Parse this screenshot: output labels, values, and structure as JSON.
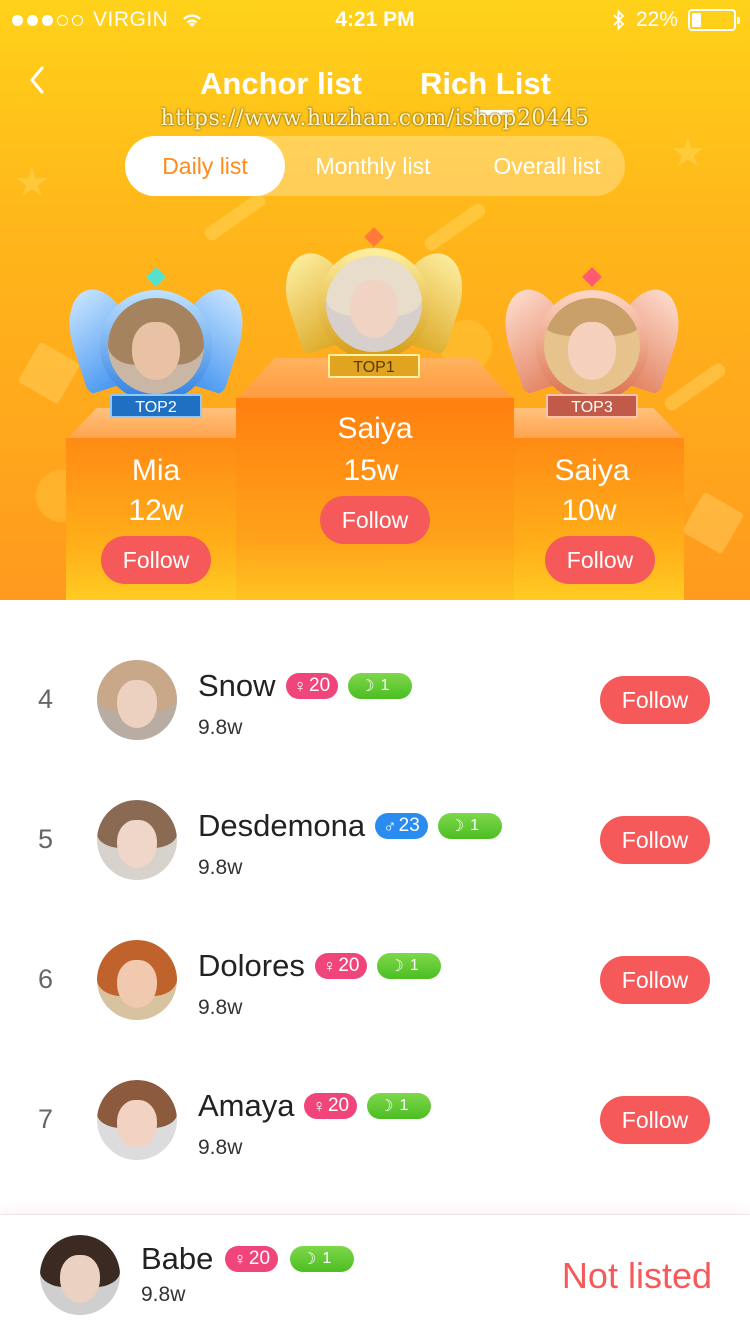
{
  "status_bar": {
    "carrier": "VIRGIN",
    "time": "4:21 PM",
    "battery": "22%",
    "battery_level": 0.22
  },
  "header": {
    "tabs": [
      {
        "label": "Anchor list",
        "active": false
      },
      {
        "label": "Rich List",
        "active": true
      }
    ],
    "watermark": "https://www.huzhan.com/ishop20445",
    "periods": [
      {
        "label": "Daily list",
        "active": true
      },
      {
        "label": "Monthly list",
        "active": false
      },
      {
        "label": "Overall list",
        "active": false
      }
    ]
  },
  "podium": [
    {
      "rank_label": "TOP2",
      "name": "Mia",
      "score": "12w",
      "follow": "Follow",
      "crown": "silver-blue"
    },
    {
      "rank_label": "TOP1",
      "name": "Saiya",
      "score": "15w",
      "follow": "Follow",
      "crown": "gold"
    },
    {
      "rank_label": "TOP3",
      "name": "Saiya",
      "score": "10w",
      "follow": "Follow",
      "crown": "bronze"
    }
  ],
  "list": [
    {
      "rank": "4",
      "name": "Snow",
      "gender": "female",
      "age": "20",
      "level": "1",
      "score": "9.8w",
      "follow": "Follow"
    },
    {
      "rank": "5",
      "name": "Desdemona",
      "gender": "male",
      "age": "23",
      "level": "1",
      "score": "9.8w",
      "follow": "Follow"
    },
    {
      "rank": "6",
      "name": "Dolores",
      "gender": "female",
      "age": "20",
      "level": "1",
      "score": "9.8w",
      "follow": "Follow"
    },
    {
      "rank": "7",
      "name": "Amaya",
      "gender": "female",
      "age": "20",
      "level": "1",
      "score": "9.8w",
      "follow": "Follow"
    }
  ],
  "me": {
    "name": "Babe",
    "gender": "female",
    "age": "20",
    "level": "1",
    "score": "9.8w",
    "status": "Not listed"
  },
  "colors": {
    "accent": "#f5595a",
    "active_tab_text": "#ff8a1e",
    "female_badge": "#f0457a",
    "male_badge": "#2b8cf0",
    "level_badge": "#5ec62e"
  }
}
